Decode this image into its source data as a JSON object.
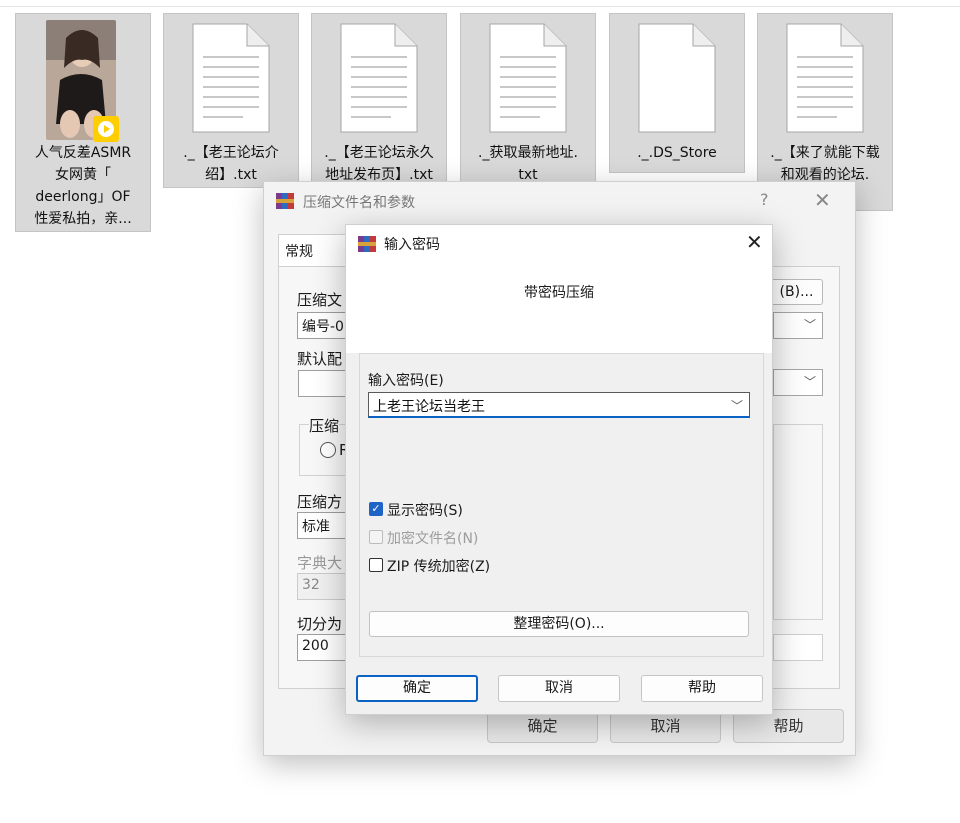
{
  "files": [
    {
      "name": "人气反差ASMR\n女网黄「\ndeerlong」OF\n性爱私拍，亲...",
      "kind": "video",
      "badge": "Player"
    },
    {
      "name": "._【老王论坛介\n绍】.txt",
      "kind": "txt"
    },
    {
      "name": "._【老王论坛永久\n地址发布页】.txt",
      "kind": "txt"
    },
    {
      "name": "._获取最新地址.\ntxt",
      "kind": "txt"
    },
    {
      "name": "._.DS_Store",
      "kind": "blank"
    },
    {
      "name": "._【来了就能下载\n和观看的论坛.\n.txt",
      "kind": "txt"
    }
  ],
  "main_dialog": {
    "title": "压缩文件名和参数",
    "help": "?",
    "close": "✕",
    "tab": "常规",
    "archive_name_label": "压缩文",
    "archive_name_value": "编号-0",
    "browse_label": "(B)...",
    "profile_label": "默认配",
    "format_group_label": "压缩",
    "format_option": "R",
    "method_label": "压缩方",
    "method_value": "标准",
    "dict_label": "字典大",
    "dict_value": "32",
    "split_label": "切分为",
    "split_value": "200",
    "ok": "确定",
    "cancel": "取消",
    "help_btn": "帮助"
  },
  "password_dialog": {
    "title": "输入密码",
    "close": "✕",
    "subtitle": "带密码压缩",
    "password_label": "输入密码(E)",
    "password_value": "上老王论坛当老王",
    "show_password": {
      "label": "显示密码(S)",
      "checked": true
    },
    "encrypt_names": {
      "label": "加密文件名(N)",
      "checked": false,
      "disabled": true
    },
    "zip_legacy": {
      "label": "ZIP 传统加密(Z)",
      "checked": false
    },
    "organize_label": "整理密码(O)...",
    "ok": "确定",
    "cancel": "取消",
    "help": "帮助"
  },
  "colors": {
    "accent": "#0a62c4",
    "checkbox": "#1f63c6",
    "badge": "#ffce00"
  },
  "icons": [
    "video-thumbnail",
    "player-badge-icon",
    "text-file-icon",
    "blank-file-icon",
    "winrar-icon",
    "close-icon",
    "chevron-down-icon",
    "check-icon",
    "radio-icon"
  ]
}
